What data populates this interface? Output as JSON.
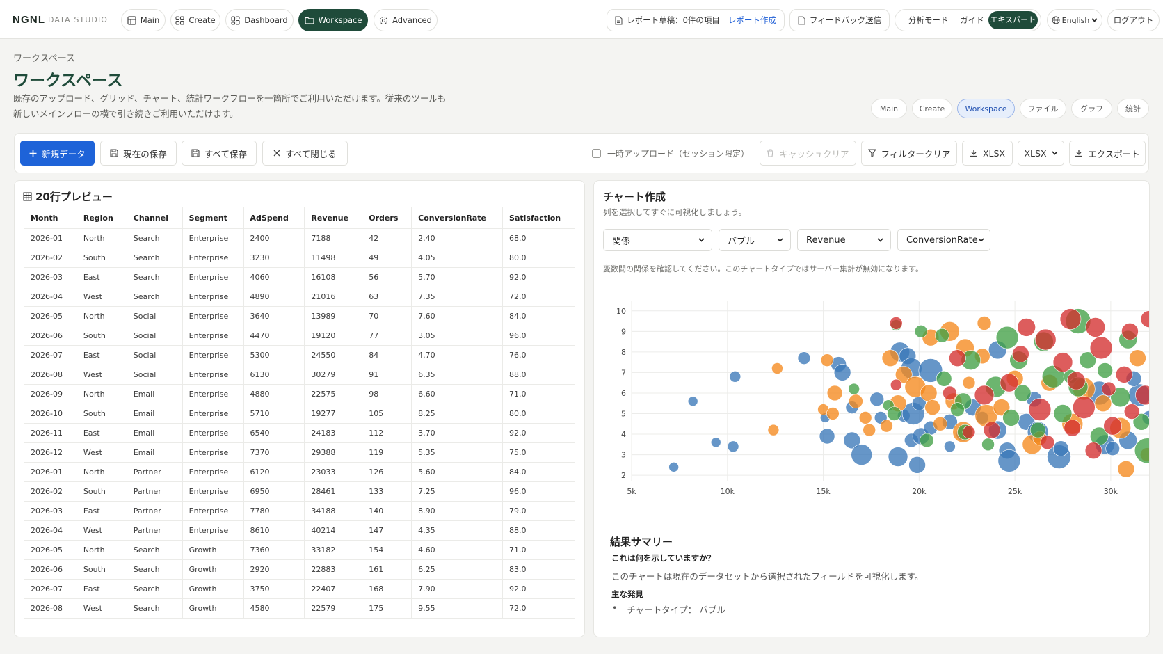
{
  "brand": {
    "name": "NGNL",
    "sub": "DATA STUDIO"
  },
  "nav": [
    {
      "label": "Main",
      "icon": "grid-icon"
    },
    {
      "label": "Create",
      "icon": "apps-icon"
    },
    {
      "label": "Dashboard",
      "icon": "dashboard-icon"
    },
    {
      "label": "Workspace",
      "icon": "folder-icon",
      "active": true
    },
    {
      "label": "Advanced",
      "icon": "gear-icon"
    }
  ],
  "header_right": {
    "report_draft": "レポート草稿：0件の項目",
    "report_create": "レポート作成",
    "feedback": "フィードバック送信",
    "analysis_mode": "分析モード",
    "guide": "ガイド",
    "expert": "エキスパート",
    "language": "English",
    "logout": "ログアウト"
  },
  "page": {
    "breadcrumb": "ワークスペース",
    "title": "ワークスペース",
    "desc_line1": "既存のアップロード、グリッド、チャート、統計ワークフローを一箇所でご利用いただけます。従来のツールも",
    "desc_line2": "新しいメインフローの横で引き続きご利用いただけます。"
  },
  "tabs": [
    "Main",
    "Create",
    "Workspace",
    "ファイル",
    "グラフ",
    "統計"
  ],
  "toolbar": {
    "new_data": "新規データ",
    "save_current": "現在の保存",
    "save_all": "すべて保存",
    "close_all": "すべて閉じる",
    "temp_upload": "一時アップロード（セッション限定）",
    "cache_clear": "キャッシュクリア",
    "filter_clear": "フィルタークリア",
    "xlsx_download": "XLSX",
    "format_select": "XLSX",
    "export": "エクスポート"
  },
  "preview": {
    "title": "20行プレビュー",
    "columns": [
      "Month",
      "Region",
      "Channel",
      "Segment",
      "AdSpend",
      "Revenue",
      "Orders",
      "ConversionRate",
      "Satisfaction"
    ],
    "rows": [
      [
        "2026-01",
        "North",
        "Search",
        "Enterprise",
        "2400",
        "7188",
        "42",
        "2.40",
        "68.0"
      ],
      [
        "2026-02",
        "South",
        "Search",
        "Enterprise",
        "3230",
        "11498",
        "49",
        "4.05",
        "80.0"
      ],
      [
        "2026-03",
        "East",
        "Search",
        "Enterprise",
        "4060",
        "16108",
        "56",
        "5.70",
        "92.0"
      ],
      [
        "2026-04",
        "West",
        "Search",
        "Enterprise",
        "4890",
        "21016",
        "63",
        "7.35",
        "72.0"
      ],
      [
        "2026-05",
        "North",
        "Social",
        "Enterprise",
        "3640",
        "13989",
        "70",
        "7.60",
        "84.0"
      ],
      [
        "2026-06",
        "South",
        "Social",
        "Enterprise",
        "4470",
        "19120",
        "77",
        "3.05",
        "96.0"
      ],
      [
        "2026-07",
        "East",
        "Social",
        "Enterprise",
        "5300",
        "24550",
        "84",
        "4.70",
        "76.0"
      ],
      [
        "2026-08",
        "West",
        "Social",
        "Enterprise",
        "6130",
        "30279",
        "91",
        "6.35",
        "88.0"
      ],
      [
        "2026-09",
        "North",
        "Email",
        "Enterprise",
        "4880",
        "22575",
        "98",
        "6.60",
        "71.0"
      ],
      [
        "2026-10",
        "South",
        "Email",
        "Enterprise",
        "5710",
        "19277",
        "105",
        "8.25",
        "80.0"
      ],
      [
        "2026-11",
        "East",
        "Email",
        "Enterprise",
        "6540",
        "24183",
        "112",
        "3.70",
        "92.0"
      ],
      [
        "2026-12",
        "West",
        "Email",
        "Enterprise",
        "7370",
        "29388",
        "119",
        "5.35",
        "75.0"
      ],
      [
        "2026-01",
        "North",
        "Partner",
        "Enterprise",
        "6120",
        "23033",
        "126",
        "5.60",
        "84.0"
      ],
      [
        "2026-02",
        "South",
        "Partner",
        "Enterprise",
        "6950",
        "28461",
        "133",
        "7.25",
        "96.0"
      ],
      [
        "2026-03",
        "East",
        "Partner",
        "Enterprise",
        "7780",
        "34188",
        "140",
        "8.90",
        "79.0"
      ],
      [
        "2026-04",
        "West",
        "Partner",
        "Enterprise",
        "8610",
        "40214",
        "147",
        "4.35",
        "88.0"
      ],
      [
        "2026-05",
        "North",
        "Search",
        "Growth",
        "7360",
        "33182",
        "154",
        "4.60",
        "71.0"
      ],
      [
        "2026-06",
        "South",
        "Search",
        "Growth",
        "2920",
        "22883",
        "161",
        "6.25",
        "83.0"
      ],
      [
        "2026-07",
        "East",
        "Search",
        "Growth",
        "3750",
        "22407",
        "168",
        "7.90",
        "92.0"
      ],
      [
        "2026-08",
        "West",
        "Search",
        "Growth",
        "4580",
        "22579",
        "175",
        "9.55",
        "72.0"
      ]
    ]
  },
  "chart_panel": {
    "title": "チャート作成",
    "subtitle": "列を選択してすぐに可視化しましょう。",
    "selects": [
      "関係",
      "バブル",
      "Revenue",
      "ConversionRate"
    ],
    "note": "変数間の関係を確認してください。このチャートタイプではサーバー集計が無効になります。"
  },
  "chart_data": {
    "type": "scatter",
    "subtype": "bubble",
    "xlabel": "",
    "ylabel": "",
    "xlim": [
      5000,
      32000
    ],
    "ylim": [
      1.7,
      10.5
    ],
    "xticks": [
      5000,
      10000,
      15000,
      20000,
      25000,
      30000
    ],
    "xtick_labels": [
      "5k",
      "10k",
      "15k",
      "20k",
      "25k",
      "30k"
    ],
    "yticks": [
      2,
      3,
      4,
      5,
      6,
      7,
      8,
      9,
      10
    ],
    "grid": true,
    "colors": [
      "#3b78b8",
      "#f5891e",
      "#43a047",
      "#d32f2f"
    ],
    "series": [
      {
        "points": [
          [
            7200,
            2.4,
            7
          ],
          [
            8200,
            5.6,
            7
          ],
          [
            9400,
            3.6,
            7
          ],
          [
            10300,
            3.4,
            8
          ],
          [
            10400,
            6.8,
            8
          ],
          [
            14000,
            7.7,
            9
          ],
          [
            15100,
            4.8,
            7
          ],
          [
            15200,
            3.9,
            11
          ],
          [
            15800,
            7.4,
            11
          ],
          [
            16000,
            7.0,
            12
          ],
          [
            16500,
            5.3,
            9
          ],
          [
            16500,
            3.7,
            12
          ],
          [
            17000,
            3.0,
            15
          ],
          [
            17800,
            5.7,
            10
          ],
          [
            18000,
            4.8,
            9
          ],
          [
            18900,
            2.9,
            14
          ],
          [
            19000,
            8.0,
            14
          ],
          [
            19200,
            4.9,
            9
          ],
          [
            19400,
            7.8,
            12
          ],
          [
            19600,
            7.2,
            15
          ],
          [
            19600,
            3.7,
            10
          ],
          [
            19700,
            5.0,
            16
          ],
          [
            20000,
            5.5,
            10
          ],
          [
            20100,
            3.9,
            12
          ],
          [
            19900,
            2.5,
            12
          ],
          [
            20600,
            4.3,
            10
          ],
          [
            20600,
            7.1,
            17
          ],
          [
            21600,
            4.6,
            11
          ],
          [
            21600,
            3.4,
            8
          ],
          [
            22300,
            4.0,
            10
          ],
          [
            22800,
            5.3,
            12
          ],
          [
            23300,
            4.8,
            9
          ],
          [
            24100,
            4.2,
            13
          ],
          [
            24600,
            3.2,
            12
          ],
          [
            24700,
            2.7,
            16
          ],
          [
            25600,
            4.6,
            12
          ],
          [
            26000,
            5.7,
            11
          ],
          [
            26200,
            4.1,
            15
          ],
          [
            27300,
            2.9,
            17
          ],
          [
            27400,
            3.3,
            11
          ],
          [
            29400,
            6.0,
            17
          ],
          [
            29700,
            3.5,
            14
          ],
          [
            30100,
            3.3,
            10
          ],
          [
            30900,
            3.7,
            13
          ],
          [
            31500,
            5.9,
            16
          ],
          [
            32000,
            4.8,
            10
          ],
          [
            24100,
            8.1,
            13
          ],
          [
            31200,
            6.7,
            11
          ]
        ]
      },
      {
        "points": [
          [
            12600,
            7.2,
            8
          ],
          [
            12400,
            4.2,
            8
          ],
          [
            15000,
            5.2,
            8
          ],
          [
            15200,
            7.6,
            9
          ],
          [
            15600,
            6.0,
            11
          ],
          [
            15500,
            5.0,
            9
          ],
          [
            16700,
            5.6,
            10
          ],
          [
            17200,
            4.8,
            9
          ],
          [
            17400,
            4.2,
            9
          ],
          [
            18900,
            5.5,
            12
          ],
          [
            18500,
            7.7,
            12
          ],
          [
            19200,
            6.9,
            12
          ],
          [
            19800,
            6.3,
            15
          ],
          [
            20500,
            6.0,
            12
          ],
          [
            20700,
            5.3,
            11
          ],
          [
            21100,
            4.5,
            10
          ],
          [
            20600,
            8.7,
            12
          ],
          [
            21600,
            9.0,
            14
          ],
          [
            21800,
            5.6,
            12
          ],
          [
            22300,
            4.1,
            15
          ],
          [
            22400,
            8.2,
            13
          ],
          [
            22600,
            6.5,
            9
          ],
          [
            23300,
            7.8,
            11
          ],
          [
            23500,
            4.9,
            16
          ],
          [
            24300,
            5.3,
            12
          ],
          [
            25000,
            6.7,
            12
          ],
          [
            25900,
            3.5,
            14
          ],
          [
            26300,
            3.8,
            10
          ],
          [
            26800,
            6.5,
            12
          ],
          [
            28000,
            4.5,
            15
          ],
          [
            28600,
            6.2,
            16
          ],
          [
            29600,
            5.5,
            12
          ],
          [
            30500,
            4.3,
            15
          ],
          [
            31400,
            7.7,
            12
          ],
          [
            30800,
            2.3,
            12
          ],
          [
            31900,
            3.0,
            10
          ],
          [
            23400,
            9.4,
            10
          ],
          [
            18300,
            4.4,
            9
          ]
        ]
      },
      {
        "points": [
          [
            16600,
            6.2,
            8
          ],
          [
            18400,
            5.4,
            8
          ],
          [
            18700,
            5.0,
            10
          ],
          [
            18800,
            9.3,
            8
          ],
          [
            20100,
            9.0,
            9
          ],
          [
            21200,
            8.8,
            10
          ],
          [
            21300,
            6.7,
            11
          ],
          [
            22300,
            5.6,
            12
          ],
          [
            22700,
            7.6,
            14
          ],
          [
            22000,
            5.2,
            10
          ],
          [
            22400,
            4.1,
            11
          ],
          [
            23600,
            3.5,
            9
          ],
          [
            24000,
            6.3,
            15
          ],
          [
            24600,
            8.7,
            16
          ],
          [
            25200,
            7.6,
            13
          ],
          [
            25400,
            6.0,
            12
          ],
          [
            26200,
            4.2,
            11
          ],
          [
            26500,
            8.5,
            14
          ],
          [
            27000,
            6.8,
            16
          ],
          [
            27500,
            5.0,
            13
          ],
          [
            28300,
            9.5,
            18
          ],
          [
            28800,
            7.6,
            12
          ],
          [
            29400,
            3.9,
            13
          ],
          [
            29700,
            7.1,
            11
          ],
          [
            30500,
            5.8,
            14
          ],
          [
            30900,
            8.6,
            13
          ],
          [
            31600,
            4.6,
            12
          ],
          [
            31900,
            3.2,
            18
          ],
          [
            27900,
            6.8,
            10
          ],
          [
            20400,
            3.7,
            10
          ],
          [
            24800,
            4.8,
            12
          ],
          [
            28300,
            6.3,
            14
          ]
        ]
      },
      {
        "points": [
          [
            18800,
            9.4,
            9
          ],
          [
            18800,
            6.4,
            8
          ],
          [
            21600,
            6.0,
            10
          ],
          [
            22000,
            7.7,
            12
          ],
          [
            23400,
            5.9,
            14
          ],
          [
            23800,
            4.2,
            12
          ],
          [
            25300,
            7.9,
            12
          ],
          [
            25600,
            9.2,
            13
          ],
          [
            26300,
            5.2,
            16
          ],
          [
            26600,
            8.6,
            15
          ],
          [
            27500,
            7.5,
            14
          ],
          [
            28000,
            4.3,
            12
          ],
          [
            28200,
            6.6,
            13
          ],
          [
            28600,
            5.3,
            16
          ],
          [
            29100,
            3.2,
            12
          ],
          [
            29500,
            8.2,
            16
          ],
          [
            30100,
            4.4,
            13
          ],
          [
            30700,
            6.9,
            12
          ],
          [
            31000,
            9.0,
            12
          ],
          [
            31800,
            5.9,
            14
          ],
          [
            32000,
            9.6,
            12
          ],
          [
            27900,
            9.6,
            15
          ],
          [
            29200,
            9.2,
            14
          ],
          [
            26700,
            3.6,
            10
          ],
          [
            22600,
            4.1,
            9
          ],
          [
            31100,
            5.1,
            11
          ],
          [
            24700,
            6.5,
            13
          ],
          [
            29900,
            6.2,
            10
          ]
        ]
      }
    ]
  },
  "summary": {
    "title": "結果サマリー",
    "question": "これは何を示していますか？",
    "text": "このチャートは現在のデータセットから選択されたフィールドを可視化します。",
    "findings_title": "主な発見",
    "findings": [
      "チャートタイプ： バブル"
    ]
  }
}
